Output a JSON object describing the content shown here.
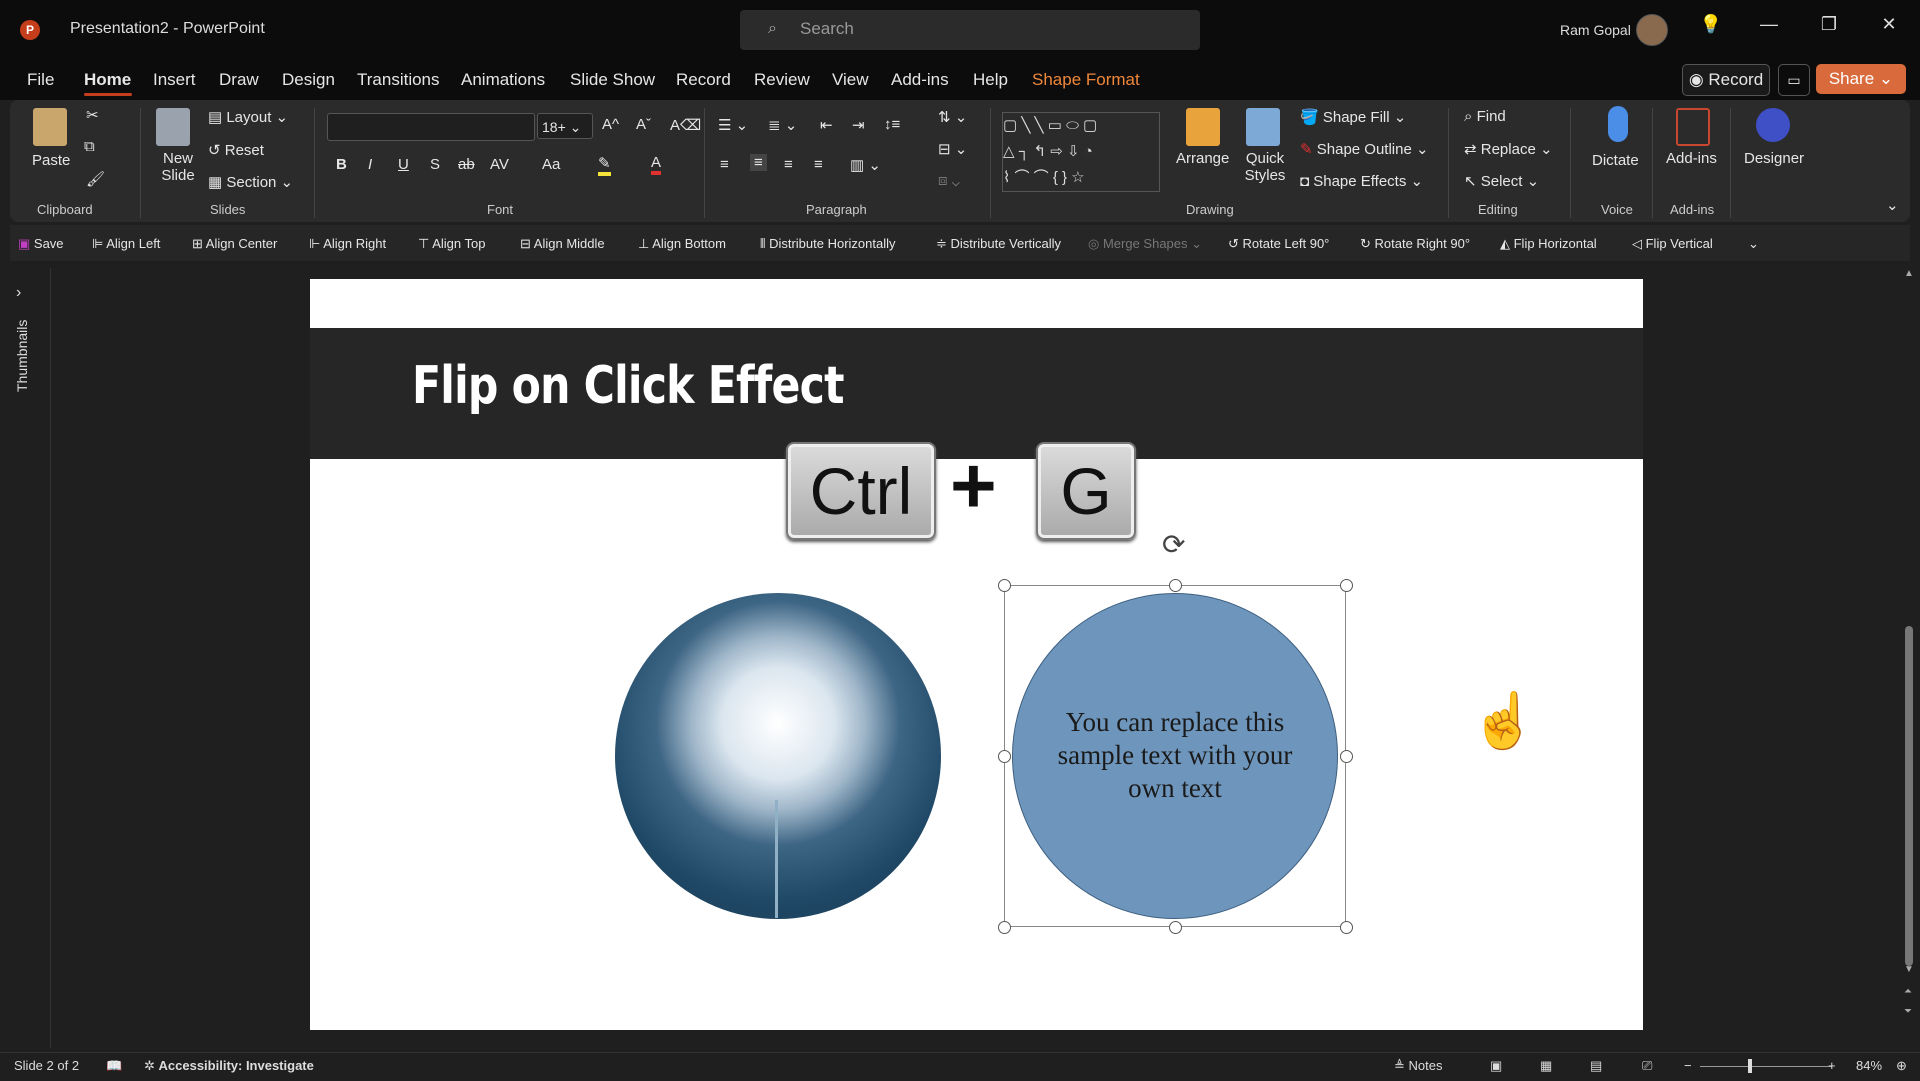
{
  "window": {
    "title": "Presentation2  -  PowerPoint",
    "search_placeholder": "Search",
    "user": "Ram Gopal",
    "controls": [
      "—",
      "❐",
      "✕"
    ]
  },
  "menu": {
    "tabs": [
      "File",
      "Home",
      "Insert",
      "Draw",
      "Design",
      "Transitions",
      "Animations",
      "Slide Show",
      "Record",
      "Review",
      "View",
      "Add-ins",
      "Help",
      "Shape Format"
    ],
    "active_tab": "Home",
    "record_label": "Record",
    "share_label": "Share"
  },
  "ribbon": {
    "clipboard": {
      "paste": "Paste",
      "group": "Clipboard"
    },
    "slides": {
      "new_slide": "New Slide",
      "layout": "Layout",
      "reset": "Reset",
      "section": "Section",
      "group": "Slides"
    },
    "font": {
      "family_value": "",
      "size_value": "18+",
      "group": "Font",
      "bold": "B",
      "italic": "I",
      "underline": "U",
      "shadow": "S",
      "strike": "ab",
      "spacing": "AV",
      "case": "Aa"
    },
    "paragraph": {
      "group": "Paragraph"
    },
    "drawing": {
      "arrange": "Arrange",
      "quick_styles": "Quick Styles",
      "shape_fill": "Shape Fill",
      "shape_outline": "Shape Outline",
      "shape_effects": "Shape Effects",
      "group": "Drawing"
    },
    "editing": {
      "find": "Find",
      "replace": "Replace",
      "select": "Select",
      "group": "Editing"
    },
    "voice": {
      "dictate": "Dictate",
      "group": "Voice"
    },
    "addins": {
      "addins": "Add-ins",
      "group": "Add-ins"
    },
    "designer": {
      "designer": "Designer"
    }
  },
  "qat": {
    "items": [
      "Save",
      "Align Left",
      "Align Center",
      "Align Right",
      "Align Top",
      "Align Middle",
      "Align Bottom",
      "Distribute Horizontally",
      "Distribute Vertically",
      "Merge Shapes",
      "Rotate Left 90°",
      "Rotate Right 90°",
      "Flip Horizontal",
      "Flip Vertical"
    ]
  },
  "thumbnails": {
    "label": "Thumbnails"
  },
  "slide": {
    "title": "Flip on Click Effect",
    "key1": "Ctrl",
    "plus": "+",
    "key2": "G",
    "circle_text": "You can replace this sample text with your own text"
  },
  "status": {
    "slide_info": "Slide 2 of 2",
    "accessibility": "Accessibility: Investigate",
    "notes": "Notes",
    "zoom": "84%"
  },
  "colors": {
    "accent": "#c43e1c",
    "share": "#d86a3b",
    "shape_format_tab": "#f0873a",
    "slide_band": "#262626",
    "circle_fill": "#6e96bc"
  }
}
